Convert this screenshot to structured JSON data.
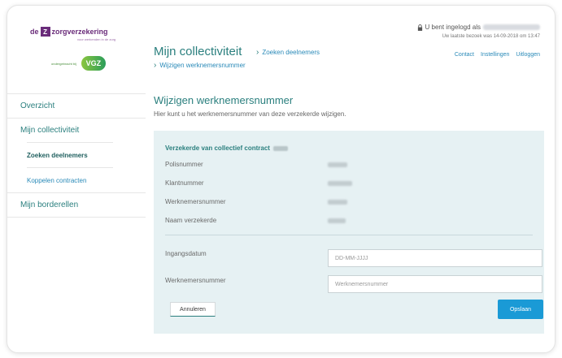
{
  "logo": {
    "de": "de",
    "number": "Z",
    "name": "zorgverzekering",
    "tagline": "voor werkenden in de zorg",
    "partner_small": "ondergebracht bij",
    "partner": "VGZ"
  },
  "header": {
    "login_text": "U bent ingelogd als",
    "last_visit": "Uw laatste bezoek was 14-09-2018 om 13:47",
    "links": [
      "Contact",
      "Instellingen",
      "Uitloggen"
    ]
  },
  "page": {
    "title": "Mijn collectiviteit",
    "breadcrumb1": "Zoeken deelnemers",
    "breadcrumb2": "Wijzigen werknemersnummer",
    "sep": "›"
  },
  "sidebar": {
    "items": [
      {
        "label": "Overzicht"
      },
      {
        "label": "Mijn collectiviteit"
      },
      {
        "label": "Zoeken deelnemers"
      },
      {
        "label": "Koppelen contracten"
      },
      {
        "label": "Mijn borderellen"
      }
    ]
  },
  "main": {
    "title": "Wijzigen werknemersnummer",
    "subtitle": "Hier kunt u het werknemersnummer van deze verzekerde wijzigen.",
    "panel_heading": "Verzekerde van collectief contract",
    "info_labels": [
      "Polisnummer",
      "Klantnummer",
      "Werknemersnummer",
      "Naam verzekerde"
    ],
    "fields": [
      {
        "label": "Ingangsdatum",
        "placeholder": "DD-MM-JJJJ"
      },
      {
        "label": "Werknemersnummer",
        "placeholder": "Werknemersnummer"
      }
    ],
    "cancel_label": "Annuleren",
    "save_label": "Opslaan"
  }
}
